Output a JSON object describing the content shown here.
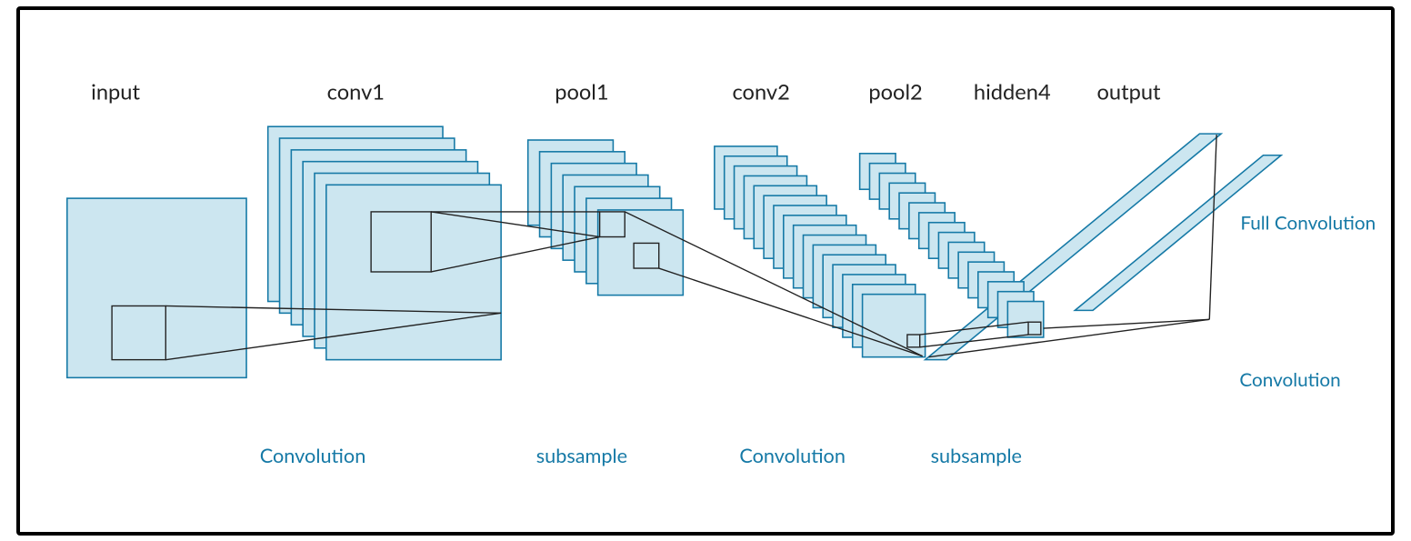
{
  "layers": {
    "input": {
      "label": "input"
    },
    "conv1": {
      "label": "conv1"
    },
    "pool1": {
      "label": "pool1"
    },
    "conv2": {
      "label": "conv2"
    },
    "pool2": {
      "label": "pool2"
    },
    "hidden4": {
      "label": "hidden4"
    },
    "output": {
      "label": "output"
    }
  },
  "ops": {
    "conv_a": "Convolution",
    "subsample_a": "subsample",
    "conv_b": "Convolution",
    "subsample_b": "subsample",
    "conv_c": "Convolution",
    "full_conv": "Full Convolution"
  },
  "colors": {
    "feature_map_fill": "#cce6f0",
    "feature_map_stroke": "#1579a6",
    "line": "#222"
  }
}
